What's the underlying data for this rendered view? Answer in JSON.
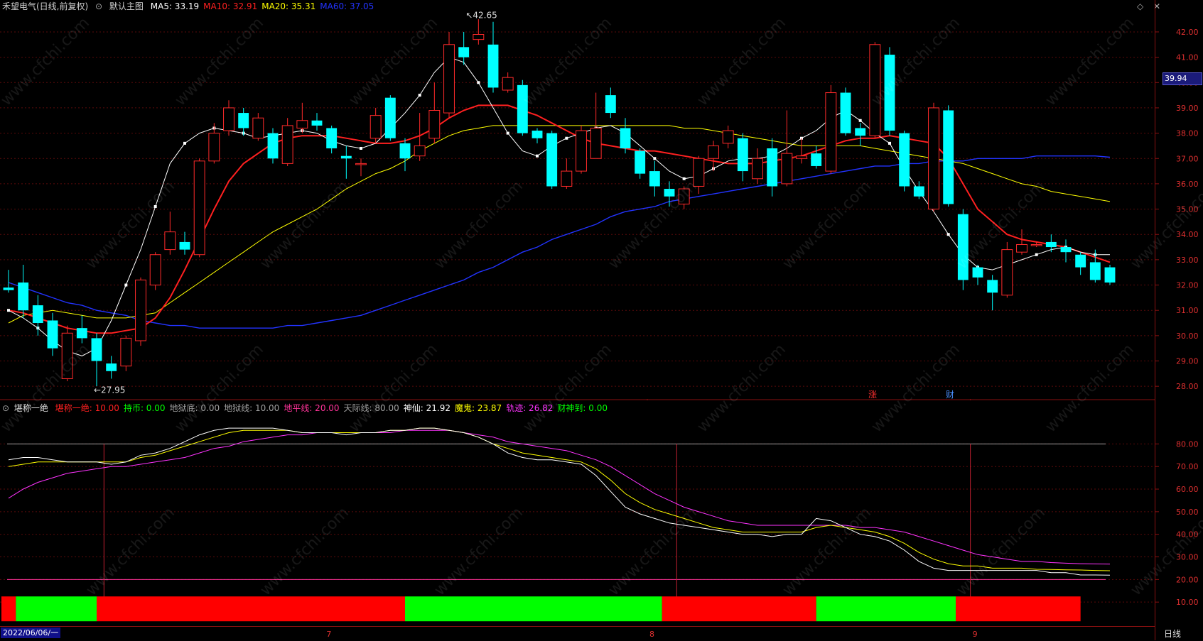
{
  "header": {
    "title": "禾望电气(日线,前复权)",
    "view_label": "默认主图",
    "ma_items": [
      {
        "label": "MA5: 33.19",
        "color": "#ffffff"
      },
      {
        "label": "MA10: 32.91",
        "color": "#ff2020"
      },
      {
        "label": "MA20: 35.31",
        "color": "#ffff00"
      },
      {
        "label": "MA60: 37.05",
        "color": "#2233ff"
      }
    ]
  },
  "indicator_header": {
    "name": "堪称一绝",
    "items": [
      {
        "label": "堪称一绝: 10.00",
        "color": "#ff2020"
      },
      {
        "label": "持币: 0.00",
        "color": "#00ff00"
      },
      {
        "label": "地狱底: 0.00",
        "color": "#a0a0a0"
      },
      {
        "label": "地狱线: 10.00",
        "color": "#a0a0a0"
      },
      {
        "label": "地平线: 20.00",
        "color": "#ff3399"
      },
      {
        "label": "天际线: 80.00",
        "color": "#a0a0a0"
      },
      {
        "label": "神仙: 21.92",
        "color": "#ffffff"
      },
      {
        "label": "魔鬼: 23.87",
        "color": "#ffff00"
      },
      {
        "label": "轨迹: 26.82",
        "color": "#ff33ff"
      },
      {
        "label": "财神到: 0.00",
        "color": "#00ff00"
      }
    ]
  },
  "price_tag": "39.94",
  "markers": {
    "zhang": "涨",
    "cai": "财"
  },
  "bottom": {
    "date": "2022/06/06/一",
    "timeframe": "日线",
    "month_labels": [
      "7",
      "8",
      "9"
    ]
  },
  "chart_data": [
    {
      "type": "candlestick",
      "title": "禾望电气(日线,前复权)",
      "ylim": [
        27.5,
        42.7
      ],
      "yticks": [
        28.0,
        29.0,
        30.0,
        31.0,
        32.0,
        33.0,
        34.0,
        35.0,
        36.0,
        37.0,
        38.0,
        39.0,
        40.0,
        41.0,
        42.0
      ],
      "high_label": "42.65",
      "low_label": "27.95",
      "candles": [
        [
          31.9,
          31.8,
          32.6,
          31.7
        ],
        [
          32.1,
          31.0,
          32.8,
          30.7
        ],
        [
          31.2,
          30.5,
          31.6,
          30.0
        ],
        [
          30.6,
          29.5,
          30.9,
          29.2
        ],
        [
          28.3,
          30.1,
          30.4,
          28.2
        ],
        [
          30.3,
          29.9,
          30.8,
          29.7
        ],
        [
          29.9,
          29.0,
          30.1,
          28.0
        ],
        [
          28.9,
          28.6,
          29.2,
          28.3
        ],
        [
          28.8,
          29.9,
          30.0,
          28.6
        ],
        [
          29.8,
          32.2,
          32.3,
          29.6
        ],
        [
          32.0,
          33.2,
          33.3,
          31.8
        ],
        [
          33.4,
          34.1,
          34.9,
          33.2
        ],
        [
          33.7,
          33.4,
          34.1,
          33.2
        ],
        [
          33.2,
          36.9,
          37.0,
          33.1
        ],
        [
          36.9,
          38.0,
          38.4,
          36.8
        ],
        [
          38.1,
          39.0,
          39.3,
          37.9
        ],
        [
          38.8,
          38.2,
          39.0,
          37.9
        ],
        [
          37.8,
          38.6,
          38.8,
          37.7
        ],
        [
          38.0,
          37.0,
          38.2,
          36.8
        ],
        [
          36.8,
          38.3,
          38.6,
          36.7
        ],
        [
          38.2,
          38.5,
          39.2,
          38.0
        ],
        [
          38.5,
          38.3,
          38.8,
          38.1
        ],
        [
          38.2,
          37.4,
          38.3,
          37.2
        ],
        [
          37.1,
          37.0,
          37.5,
          36.2
        ],
        [
          36.8,
          36.8,
          37.0,
          36.3
        ],
        [
          37.8,
          38.7,
          39.0,
          37.6
        ],
        [
          39.4,
          37.8,
          39.5,
          37.7
        ],
        [
          37.6,
          37.0,
          37.8,
          36.5
        ],
        [
          37.1,
          37.5,
          38.8,
          36.9
        ],
        [
          37.8,
          38.9,
          40.0,
          37.6
        ],
        [
          38.8,
          41.5,
          42.0,
          38.6
        ],
        [
          41.4,
          41.0,
          42.0,
          40.7
        ],
        [
          41.7,
          41.9,
          42.5,
          41.5
        ],
        [
          41.5,
          39.8,
          42.4,
          39.6
        ],
        [
          39.7,
          40.2,
          40.4,
          39.6
        ],
        [
          39.9,
          38.0,
          40.1,
          37.9
        ],
        [
          38.1,
          37.8,
          38.2,
          37.6
        ],
        [
          38.0,
          35.9,
          38.1,
          35.8
        ],
        [
          35.9,
          36.5,
          37.0,
          35.8
        ],
        [
          36.5,
          38.1,
          38.3,
          36.4
        ],
        [
          37.0,
          38.2,
          39.6,
          37.0
        ],
        [
          39.5,
          38.8,
          39.8,
          38.6
        ],
        [
          38.2,
          37.4,
          38.6,
          37.2
        ],
        [
          37.3,
          36.4,
          37.4,
          36.2
        ],
        [
          36.5,
          35.9,
          36.9,
          35.5
        ],
        [
          35.8,
          35.5,
          36.1,
          35.1
        ],
        [
          35.2,
          35.8,
          35.9,
          35.0
        ],
        [
          35.9,
          37.0,
          37.1,
          35.6
        ],
        [
          37.0,
          37.5,
          37.7,
          36.5
        ],
        [
          37.6,
          38.1,
          38.3,
          37.4
        ],
        [
          37.8,
          36.5,
          38.0,
          36.1
        ],
        [
          36.2,
          37.0,
          37.4,
          36.0
        ],
        [
          37.4,
          35.9,
          37.8,
          35.5
        ],
        [
          36.0,
          37.2,
          38.9,
          35.9
        ],
        [
          37.0,
          37.1,
          37.8,
          36.8
        ],
        [
          37.2,
          36.7,
          37.5,
          36.6
        ],
        [
          36.5,
          39.6,
          39.9,
          36.4
        ],
        [
          39.6,
          38.0,
          39.8,
          37.9
        ],
        [
          38.2,
          37.9,
          38.4,
          37.5
        ],
        [
          37.9,
          41.5,
          41.6,
          37.8
        ],
        [
          41.1,
          38.1,
          41.4,
          37.9
        ],
        [
          38.0,
          35.9,
          38.1,
          35.7
        ],
        [
          35.9,
          35.5,
          36.1,
          35.4
        ],
        [
          35.0,
          39.0,
          39.2,
          34.9
        ],
        [
          38.9,
          35.2,
          39.1,
          35.1
        ],
        [
          34.8,
          32.2,
          35.0,
          31.8
        ],
        [
          32.7,
          32.3,
          32.8,
          32.0
        ],
        [
          32.2,
          31.7,
          32.4,
          31.0
        ],
        [
          31.6,
          33.4,
          33.7,
          31.5
        ],
        [
          33.3,
          33.6,
          34.2,
          33.2
        ],
        [
          33.6,
          33.6,
          33.7,
          33.5
        ],
        [
          33.7,
          33.5,
          34.0,
          33.3
        ],
        [
          33.5,
          33.3,
          33.8,
          32.9
        ],
        [
          33.2,
          32.7,
          33.3,
          32.4
        ],
        [
          32.9,
          32.2,
          33.4,
          32.1
        ],
        [
          32.7,
          32.1,
          32.8,
          32.0
        ]
      ],
      "series": [
        {
          "name": "MA5",
          "color": "#ffffff",
          "values": [
            31.0,
            30.7,
            30.3,
            29.8,
            29.4,
            29.2,
            29.5,
            30.6,
            32.0,
            33.4,
            35.1,
            36.8,
            37.6,
            38.0,
            38.2,
            38.1,
            38.0,
            37.8,
            37.9,
            38.0,
            38.1,
            38.0,
            37.7,
            37.5,
            37.4,
            37.6,
            38.2,
            38.8,
            39.5,
            40.4,
            41.0,
            40.8,
            40.0,
            39.0,
            38.0,
            37.3,
            37.1,
            37.5,
            37.8,
            38.0,
            38.2,
            38.3,
            38.0,
            37.5,
            37.0,
            36.5,
            36.2,
            36.3,
            36.6,
            36.9,
            37.0,
            37.0,
            37.1,
            37.4,
            37.8,
            38.1,
            38.6,
            38.9,
            38.5,
            38.0,
            37.6,
            36.6,
            35.7,
            34.9,
            34.0,
            33.2,
            32.7,
            32.6,
            32.8,
            33.0,
            33.2,
            33.4,
            33.5,
            33.3,
            33.2,
            33.2
          ]
        },
        {
          "name": "MA10",
          "color": "#ff2020",
          "values": [
            31.0,
            30.9,
            30.7,
            30.5,
            30.3,
            30.2,
            30.1,
            30.1,
            30.2,
            30.3,
            30.7,
            31.5,
            32.6,
            33.8,
            35.0,
            36.1,
            36.8,
            37.2,
            37.6,
            37.8,
            37.9,
            37.9,
            37.9,
            37.8,
            37.7,
            37.6,
            37.6,
            37.7,
            37.9,
            38.2,
            38.6,
            38.9,
            39.1,
            39.1,
            39.1,
            38.9,
            38.7,
            38.4,
            38.1,
            37.8,
            37.6,
            37.5,
            37.4,
            37.3,
            37.3,
            37.2,
            37.1,
            37.0,
            36.9,
            36.8,
            36.8,
            36.8,
            36.9,
            37.0,
            37.1,
            37.3,
            37.5,
            37.7,
            37.8,
            37.8,
            37.9,
            37.8,
            37.7,
            37.6,
            37.0,
            36.0,
            35.0,
            34.5,
            34.0,
            33.8,
            33.7,
            33.6,
            33.5,
            33.3,
            33.1,
            32.9
          ]
        },
        {
          "name": "MA20",
          "color": "#ffff00",
          "values": [
            30.5,
            30.8,
            30.9,
            31.0,
            30.9,
            30.8,
            30.7,
            30.7,
            30.7,
            30.8,
            30.9,
            31.3,
            31.7,
            32.1,
            32.5,
            32.9,
            33.3,
            33.7,
            34.1,
            34.4,
            34.7,
            35.0,
            35.4,
            35.8,
            36.1,
            36.4,
            36.6,
            36.9,
            37.3,
            37.6,
            37.9,
            38.1,
            38.2,
            38.3,
            38.3,
            38.3,
            38.3,
            38.3,
            38.3,
            38.3,
            38.3,
            38.3,
            38.3,
            38.3,
            38.3,
            38.3,
            38.2,
            38.2,
            38.1,
            38.0,
            37.9,
            37.8,
            37.7,
            37.6,
            37.5,
            37.5,
            37.5,
            37.5,
            37.5,
            37.4,
            37.3,
            37.2,
            37.1,
            37.0,
            36.9,
            36.8,
            36.6,
            36.4,
            36.2,
            36.0,
            35.9,
            35.7,
            35.6,
            35.5,
            35.4,
            35.3
          ]
        },
        {
          "name": "MA60",
          "color": "#2233ff",
          "values": [
            32.1,
            31.9,
            31.7,
            31.5,
            31.3,
            31.2,
            31.0,
            30.9,
            30.8,
            30.6,
            30.5,
            30.4,
            30.4,
            30.3,
            30.3,
            30.3,
            30.3,
            30.3,
            30.3,
            30.4,
            30.4,
            30.5,
            30.6,
            30.7,
            30.8,
            31.0,
            31.2,
            31.4,
            31.6,
            31.8,
            32.0,
            32.2,
            32.5,
            32.7,
            33.0,
            33.3,
            33.5,
            33.8,
            34.0,
            34.2,
            34.4,
            34.7,
            34.9,
            35.0,
            35.1,
            35.3,
            35.4,
            35.5,
            35.6,
            35.7,
            35.8,
            35.9,
            36.0,
            36.1,
            36.2,
            36.3,
            36.4,
            36.5,
            36.6,
            36.7,
            36.7,
            36.8,
            36.8,
            36.9,
            36.9,
            36.9,
            37.0,
            37.0,
            37.0,
            37.0,
            37.1,
            37.1,
            37.1,
            37.1,
            37.1,
            37.05
          ]
        }
      ]
    },
    {
      "type": "line",
      "title": "堪称一绝",
      "ylim": [
        0,
        93
      ],
      "yticks": [
        10.0,
        20.0,
        30.0,
        40.0,
        50.0,
        60.0,
        70.0,
        80.0
      ],
      "reference_lines": [
        {
          "name": "天际线",
          "value": 80,
          "color": "#a0a0a0"
        },
        {
          "name": "地平线",
          "value": 20,
          "color": "#ff3399"
        }
      ],
      "vertical_lines_at_index": [
        6,
        45,
        65
      ],
      "series": [
        {
          "name": "神仙",
          "color": "#ffffff",
          "values": [
            73,
            74,
            74,
            73,
            72,
            72,
            72,
            71,
            72,
            75,
            76,
            78,
            81,
            84,
            86,
            87,
            87,
            87,
            87,
            86,
            85,
            85,
            85,
            84,
            85,
            85,
            86,
            86,
            87,
            87,
            86,
            85,
            83,
            80,
            76,
            74,
            73,
            73,
            72,
            71,
            66,
            59,
            52,
            49,
            47,
            45,
            44,
            43,
            42,
            41,
            40,
            40,
            39,
            40,
            40,
            47,
            46,
            43,
            40,
            39,
            37,
            33,
            28,
            25,
            24,
            24,
            24,
            24,
            24,
            24,
            24,
            23,
            23,
            22,
            22,
            21.92
          ]
        },
        {
          "name": "魔鬼",
          "color": "#ffff00",
          "values": [
            70,
            71,
            72,
            72,
            72,
            72,
            72,
            72,
            72,
            74,
            75,
            77,
            79,
            81,
            83,
            85,
            86,
            86,
            86,
            86,
            85,
            85,
            85,
            85,
            85,
            85,
            86,
            86,
            87,
            87,
            86,
            85,
            83,
            80,
            78,
            76,
            75,
            74,
            73,
            72,
            69,
            64,
            58,
            54,
            51,
            49,
            47,
            45,
            43,
            42,
            41,
            41,
            41,
            41,
            41,
            43,
            44,
            43,
            42,
            41,
            39,
            36,
            32,
            29,
            27,
            26,
            26,
            25,
            25,
            25,
            24.5,
            24.4,
            24.3,
            24.2,
            24.0,
            23.87
          ]
        },
        {
          "name": "轨迹",
          "color": "#ff33ff",
          "values": [
            56,
            60,
            63,
            65,
            67,
            68,
            69,
            70,
            70,
            71,
            72,
            73,
            74,
            76,
            78,
            79,
            81,
            82,
            83,
            84,
            84,
            85,
            85,
            85,
            85,
            85,
            85,
            86,
            86,
            86,
            86,
            85,
            84,
            83,
            81,
            80,
            79,
            78,
            77,
            75,
            73,
            70,
            66,
            62,
            58,
            55,
            52,
            50,
            48,
            46,
            45,
            44,
            44,
            44,
            44,
            44,
            44,
            44,
            43,
            43,
            42,
            41,
            39,
            37,
            35,
            33,
            31,
            30,
            29,
            28,
            28,
            27.5,
            27.2,
            27.0,
            26.9,
            26.82
          ]
        }
      ],
      "signal_bar": {
        "colors": {
          "hold": "#00ff00",
          "sell": "#ff0000"
        },
        "segments": [
          {
            "from": 0,
            "to": 1,
            "state": "sell"
          },
          {
            "from": 1,
            "to": 6.5,
            "state": "hold"
          },
          {
            "from": 6.5,
            "to": 27.5,
            "state": "sell"
          },
          {
            "from": 27.5,
            "to": 45,
            "state": "hold"
          },
          {
            "from": 45,
            "to": 55.5,
            "state": "sell"
          },
          {
            "from": 55.5,
            "to": 65,
            "state": "hold"
          },
          {
            "from": 65,
            "to": 72,
            "state": "sell"
          }
        ]
      }
    }
  ],
  "watermark": "www.cfchi.com"
}
